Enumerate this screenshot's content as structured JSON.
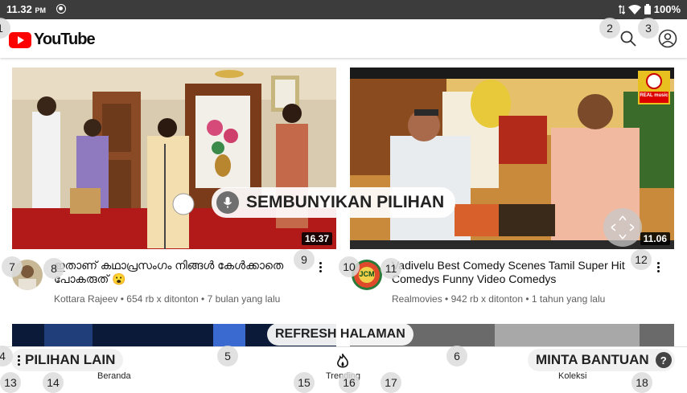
{
  "status_bar": {
    "time": "11.32",
    "ampm": "PM",
    "battery": "100%"
  },
  "app": {
    "name": "YouTube"
  },
  "videos": [
    {
      "title": "ഇതാണ് കഥാപ്രസംഗം നിങ്ങൾ കേൾക്കാതെ പോകരുത് 😮",
      "channel": "Kottara Rajeev",
      "views": "654 rb x ditonton",
      "age": "7 bulan yang lalu",
      "duration": "16.37"
    },
    {
      "title": "Vadivelu Best Comedy Scenes Tamil Super Hit Comedys Funny Video Comedys",
      "channel": "Realmovies",
      "views": "942 rb x ditonton",
      "age": "1 tahun yang lalu",
      "duration": "11.06",
      "channel_logo": "REAL music",
      "avatar_text": "JCM"
    }
  ],
  "meta_separator": "•",
  "voice_overlay": {
    "hide_label": "SEMBUNYIKAN PILIHAN",
    "refresh_label": "REFRESH HALAMAN",
    "more_label": "PILIHAN LAIN",
    "help_label": "MINTA BANTUAN",
    "help_icon": "?"
  },
  "bottom_nav": {
    "home": "Beranda",
    "trending": "Trending",
    "library": "Koleksi"
  },
  "number_badges": [
    "1",
    "2",
    "3",
    "4",
    "5",
    "6",
    "7",
    "8",
    "9",
    "10",
    "11",
    "12",
    "13",
    "14",
    "15",
    "16",
    "17",
    "18"
  ],
  "colors": {
    "brand_red": "#ff0000",
    "status_bar": "#3c3c3c"
  }
}
